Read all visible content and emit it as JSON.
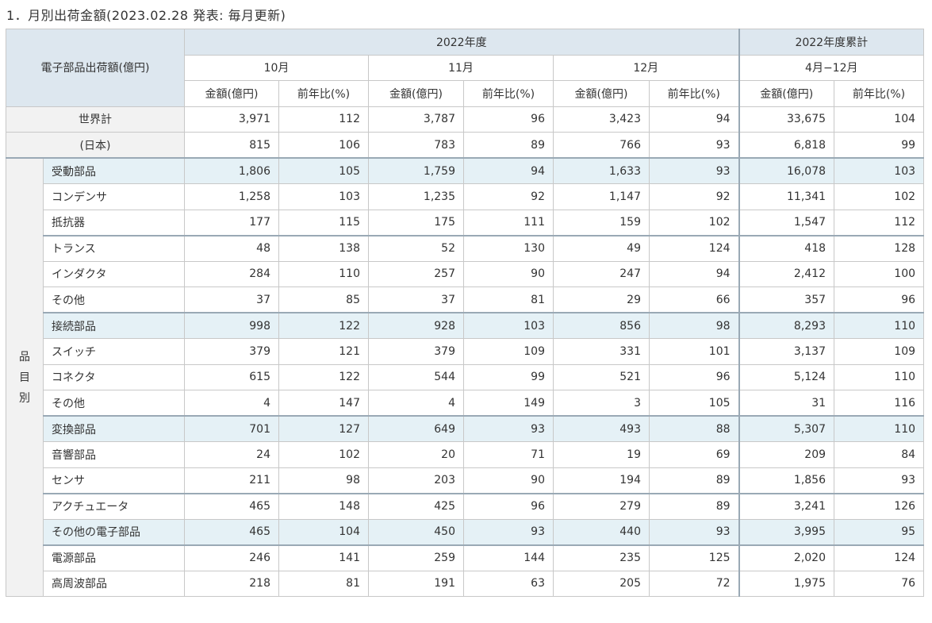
{
  "page": {
    "title": "1．月別出荷金額(2023.02.28 発表: 毎月更新)"
  },
  "header": {
    "corner": "電子部品出荷額(億円)",
    "fy": "2022年度",
    "cumulative": "2022年度累計",
    "months": [
      "10月",
      "11月",
      "12月",
      "4月−12月"
    ],
    "amount": "金額(億円)",
    "yoy": "前年比(%)"
  },
  "totals": [
    {
      "label": "世界計",
      "values": [
        "3,971",
        "112",
        "3,787",
        "96",
        "3,423",
        "94",
        "33,675",
        "104"
      ]
    },
    {
      "label": "(日本)",
      "values": [
        "815",
        "106",
        "783",
        "89",
        "766",
        "93",
        "6,818",
        "99"
      ]
    }
  ],
  "side_label": [
    "品",
    "目",
    "別"
  ],
  "rows": [
    {
      "label": "受動部品",
      "category": true,
      "values": [
        "1,806",
        "105",
        "1,759",
        "94",
        "1,633",
        "93",
        "16,078",
        "103"
      ]
    },
    {
      "label": "コンデンサ",
      "category": false,
      "values": [
        "1,258",
        "103",
        "1,235",
        "92",
        "1,147",
        "92",
        "11,341",
        "102"
      ]
    },
    {
      "label": "抵抗器",
      "category": false,
      "values": [
        "177",
        "115",
        "175",
        "111",
        "159",
        "102",
        "1,547",
        "112"
      ]
    },
    {
      "label": "トランス",
      "category": false,
      "values": [
        "48",
        "138",
        "52",
        "130",
        "49",
        "124",
        "418",
        "128"
      ]
    },
    {
      "label": "インダクタ",
      "category": false,
      "values": [
        "284",
        "110",
        "257",
        "90",
        "247",
        "94",
        "2,412",
        "100"
      ]
    },
    {
      "label": "その他",
      "category": false,
      "values": [
        "37",
        "85",
        "37",
        "81",
        "29",
        "66",
        "357",
        "96"
      ]
    },
    {
      "label": "接続部品",
      "category": true,
      "values": [
        "998",
        "122",
        "928",
        "103",
        "856",
        "98",
        "8,293",
        "110"
      ]
    },
    {
      "label": "スイッチ",
      "category": false,
      "values": [
        "379",
        "121",
        "379",
        "109",
        "331",
        "101",
        "3,137",
        "109"
      ]
    },
    {
      "label": "コネクタ",
      "category": false,
      "values": [
        "615",
        "122",
        "544",
        "99",
        "521",
        "96",
        "5,124",
        "110"
      ]
    },
    {
      "label": "その他",
      "category": false,
      "values": [
        "4",
        "147",
        "4",
        "149",
        "3",
        "105",
        "31",
        "116"
      ]
    },
    {
      "label": "変換部品",
      "category": true,
      "values": [
        "701",
        "127",
        "649",
        "93",
        "493",
        "88",
        "5,307",
        "110"
      ]
    },
    {
      "label": "音響部品",
      "category": false,
      "values": [
        "24",
        "102",
        "20",
        "71",
        "19",
        "69",
        "209",
        "84"
      ]
    },
    {
      "label": "センサ",
      "category": false,
      "values": [
        "211",
        "98",
        "203",
        "90",
        "194",
        "89",
        "1,856",
        "93"
      ]
    },
    {
      "label": "アクチュエータ",
      "category": false,
      "values": [
        "465",
        "148",
        "425",
        "96",
        "279",
        "89",
        "3,241",
        "126"
      ]
    },
    {
      "label": "その他の電子部品",
      "category": true,
      "values": [
        "465",
        "104",
        "450",
        "93",
        "440",
        "93",
        "3,995",
        "95"
      ]
    },
    {
      "label": "電源部品",
      "category": false,
      "values": [
        "246",
        "141",
        "259",
        "144",
        "235",
        "125",
        "2,020",
        "124"
      ]
    },
    {
      "label": "高周波部品",
      "category": false,
      "values": [
        "218",
        "81",
        "191",
        "63",
        "205",
        "72",
        "1,975",
        "76"
      ]
    }
  ]
}
